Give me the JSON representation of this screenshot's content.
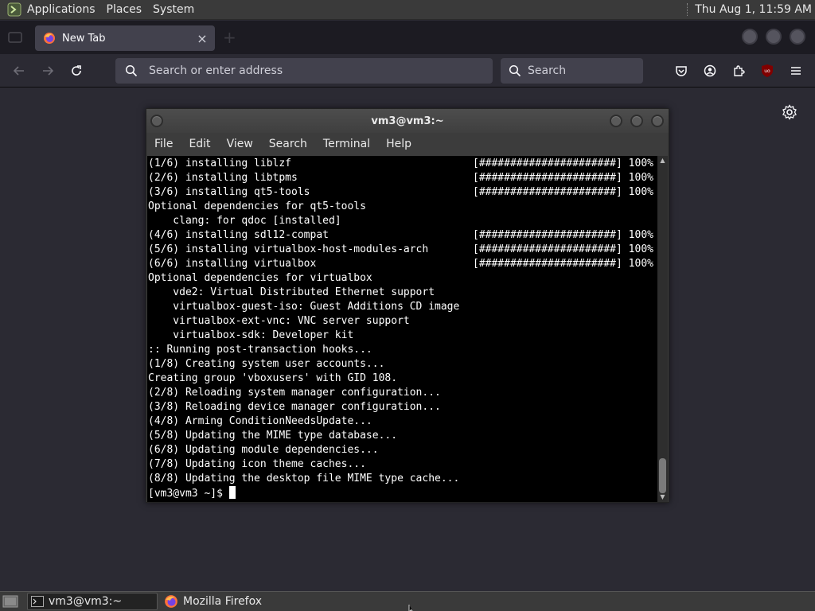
{
  "top_panel": {
    "menus": [
      "Applications",
      "Places",
      "System"
    ],
    "clock": "Thu Aug  1, 11:59 AM"
  },
  "browser": {
    "tab": {
      "title": "New Tab",
      "close": "×"
    },
    "new_tab": "+",
    "address_placeholder": "Search or enter address",
    "search_placeholder": "Search",
    "colors": {
      "toolbar": "#2b2a33",
      "field": "#42414d",
      "accent_ublock": "#800000"
    }
  },
  "terminal": {
    "title": "vm3@vm3:~",
    "menu": [
      "File",
      "Edit",
      "View",
      "Search",
      "Terminal",
      "Help"
    ],
    "lines": [
      {
        "left": "(1/6) installing liblzf",
        "right": "[######################] 100%"
      },
      {
        "left": "(2/6) installing libtpms",
        "right": "[######################] 100%"
      },
      {
        "left": "(3/6) installing qt5-tools",
        "right": "[######################] 100%"
      },
      {
        "left": "Optional dependencies for qt5-tools",
        "right": ""
      },
      {
        "left": "    clang: for qdoc [installed]",
        "right": ""
      },
      {
        "left": "(4/6) installing sdl12-compat",
        "right": "[######################] 100%"
      },
      {
        "left": "(5/6) installing virtualbox-host-modules-arch",
        "right": "[######################] 100%"
      },
      {
        "left": "(6/6) installing virtualbox",
        "right": "[######################] 100%"
      },
      {
        "left": "Optional dependencies for virtualbox",
        "right": ""
      },
      {
        "left": "    vde2: Virtual Distributed Ethernet support",
        "right": ""
      },
      {
        "left": "    virtualbox-guest-iso: Guest Additions CD image",
        "right": ""
      },
      {
        "left": "    virtualbox-ext-vnc: VNC server support",
        "right": ""
      },
      {
        "left": "    virtualbox-sdk: Developer kit",
        "right": ""
      },
      {
        "left": ":: Running post-transaction hooks...",
        "right": ""
      },
      {
        "left": "(1/8) Creating system user accounts...",
        "right": ""
      },
      {
        "left": "Creating group 'vboxusers' with GID 108.",
        "right": ""
      },
      {
        "left": "(2/8) Reloading system manager configuration...",
        "right": ""
      },
      {
        "left": "(3/8) Reloading device manager configuration...",
        "right": ""
      },
      {
        "left": "(4/8) Arming ConditionNeedsUpdate...",
        "right": ""
      },
      {
        "left": "(5/8) Updating the MIME type database...",
        "right": ""
      },
      {
        "left": "(6/8) Updating module dependencies...",
        "right": ""
      },
      {
        "left": "(7/8) Updating icon theme caches...",
        "right": ""
      },
      {
        "left": "(8/8) Updating the desktop file MIME type cache...",
        "right": ""
      }
    ],
    "prompt": "[vm3@vm3 ~]$ "
  },
  "taskbar": {
    "tasks": [
      {
        "label": "vm3@vm3:~",
        "active": true,
        "icon": "terminal-icon"
      },
      {
        "label": "Mozilla Firefox",
        "active": false,
        "icon": "firefox-icon"
      }
    ]
  }
}
